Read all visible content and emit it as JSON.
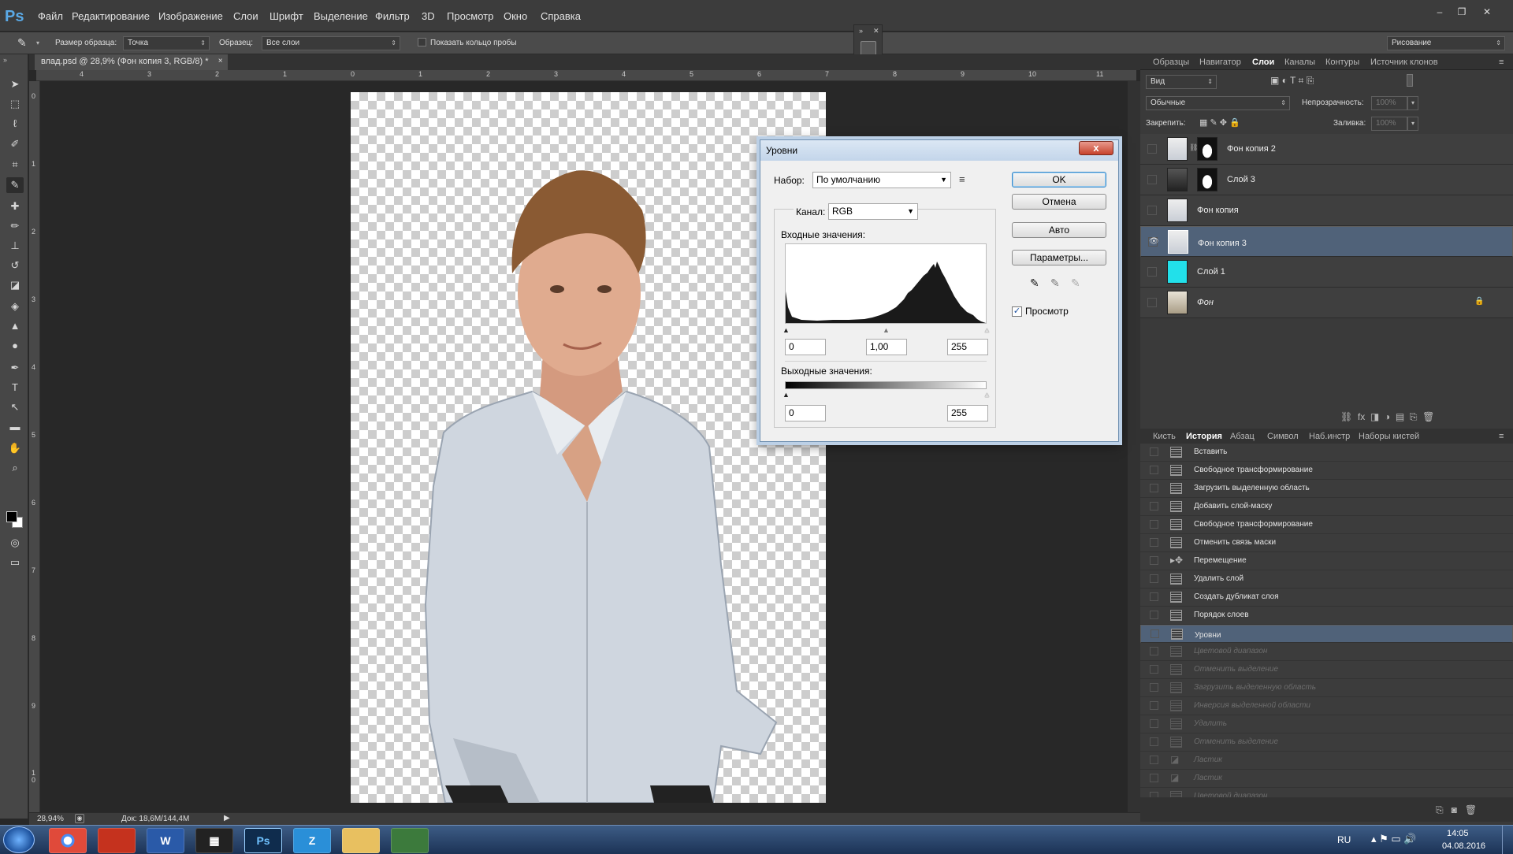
{
  "app": {
    "logo": "Ps"
  },
  "menu": [
    "Файл",
    "Редактирование",
    "Изображение",
    "Слои",
    "Шрифт",
    "Выделение",
    "Фильтр",
    "3D",
    "Просмотр",
    "Окно",
    "Справка"
  ],
  "options": {
    "sample_size_label": "Размер образца:",
    "sample_size_value": "Точка",
    "sample_label": "Образец:",
    "sample_value": "Все слои",
    "show_ring_label": "Показать кольцо пробы",
    "workspace": "Рисование"
  },
  "document": {
    "tab_title": "влад.psd @ 28,9% (Фон копия 3, RGB/8) *",
    "tab_close": "×",
    "zoom": "28,94%",
    "doc_size": "Док: 18,6M/144,4M"
  },
  "rulers": {
    "h": [
      "4",
      "3",
      "2",
      "1",
      "0",
      "1",
      "2",
      "3",
      "4",
      "5",
      "6",
      "7",
      "8",
      "9",
      "10",
      "11"
    ],
    "v": [
      "0",
      "1",
      "2",
      "3",
      "4",
      "5",
      "6",
      "7",
      "8",
      "9",
      "1\n0"
    ]
  },
  "layers_panel": {
    "tabs": [
      "Образцы",
      "Навигатор",
      "Слои",
      "Каналы",
      "Контуры",
      "Источник клонов"
    ],
    "active_tab": "Слои",
    "filter_value": "Вид",
    "blend_mode": "Обычные",
    "opacity_label": "Непрозрачность:",
    "opacity_value": "100%",
    "lock_label": "Закрепить:",
    "fill_label": "Заливка:",
    "fill_value": "100%",
    "layers": [
      {
        "name": "Фон копия 2",
        "visible": false,
        "selected": false
      },
      {
        "name": "Слой 3",
        "visible": false,
        "selected": false
      },
      {
        "name": "Фон копия",
        "visible": false,
        "selected": false
      },
      {
        "name": "Фон копия 3",
        "visible": true,
        "selected": true
      },
      {
        "name": "Слой 1",
        "visible": false,
        "selected": false,
        "color": "#22e0ea"
      },
      {
        "name": "Фон",
        "visible": false,
        "selected": false,
        "locked": true
      }
    ]
  },
  "history_panel": {
    "tabs": [
      "Кисть",
      "История",
      "Абзац",
      "Символ",
      "Наб.инстр",
      "Наборы кистей"
    ],
    "active_tab": "История",
    "items": [
      {
        "label": "Вставить",
        "state": "normal"
      },
      {
        "label": "Свободное трансформирование",
        "state": "normal"
      },
      {
        "label": "Загрузить выделенную область",
        "state": "normal"
      },
      {
        "label": "Добавить слой-маску",
        "state": "normal"
      },
      {
        "label": "Свободное трансформирование",
        "state": "normal"
      },
      {
        "label": "Отменить связь маски",
        "state": "normal"
      },
      {
        "label": "Перемещение",
        "state": "normal"
      },
      {
        "label": "Удалить слой",
        "state": "normal"
      },
      {
        "label": "Создать дубликат слоя",
        "state": "normal"
      },
      {
        "label": "Порядок слоев",
        "state": "normal"
      },
      {
        "label": "Уровни",
        "state": "selected"
      },
      {
        "label": "Цветовой диапазон",
        "state": "disabled"
      },
      {
        "label": "Отменить выделение",
        "state": "disabled"
      },
      {
        "label": "Загрузить выделенную область",
        "state": "disabled"
      },
      {
        "label": "Инверсия выделенной области",
        "state": "disabled"
      },
      {
        "label": "Удалить",
        "state": "disabled"
      },
      {
        "label": "Отменить выделение",
        "state": "disabled"
      },
      {
        "label": "Ластик",
        "state": "disabled"
      },
      {
        "label": "Ластик",
        "state": "disabled"
      },
      {
        "label": "Цветовой диапазон",
        "state": "disabled"
      }
    ]
  },
  "levels_dialog": {
    "title": "Уровни",
    "close": "x",
    "preset_label": "Набор:",
    "preset_value": "По умолчанию",
    "channel_label": "Канал:",
    "channel_value": "RGB",
    "input_label": "Входные значения:",
    "input_black": "0",
    "input_gamma": "1,00",
    "input_white": "255",
    "output_label": "Выходные значения:",
    "output_black": "0",
    "output_white": "255",
    "ok": "OK",
    "cancel": "Отмена",
    "auto": "Авто",
    "options": "Параметры...",
    "preview_label": "Просмотр",
    "preview_checked": true
  },
  "taskbar": {
    "apps": [
      "Chrome",
      "Acrobat",
      "W",
      "Film",
      "Ps",
      "Z",
      "Folder",
      "Monitor"
    ],
    "lang": "RU",
    "time": "14:05",
    "date": "04.08.2016"
  }
}
